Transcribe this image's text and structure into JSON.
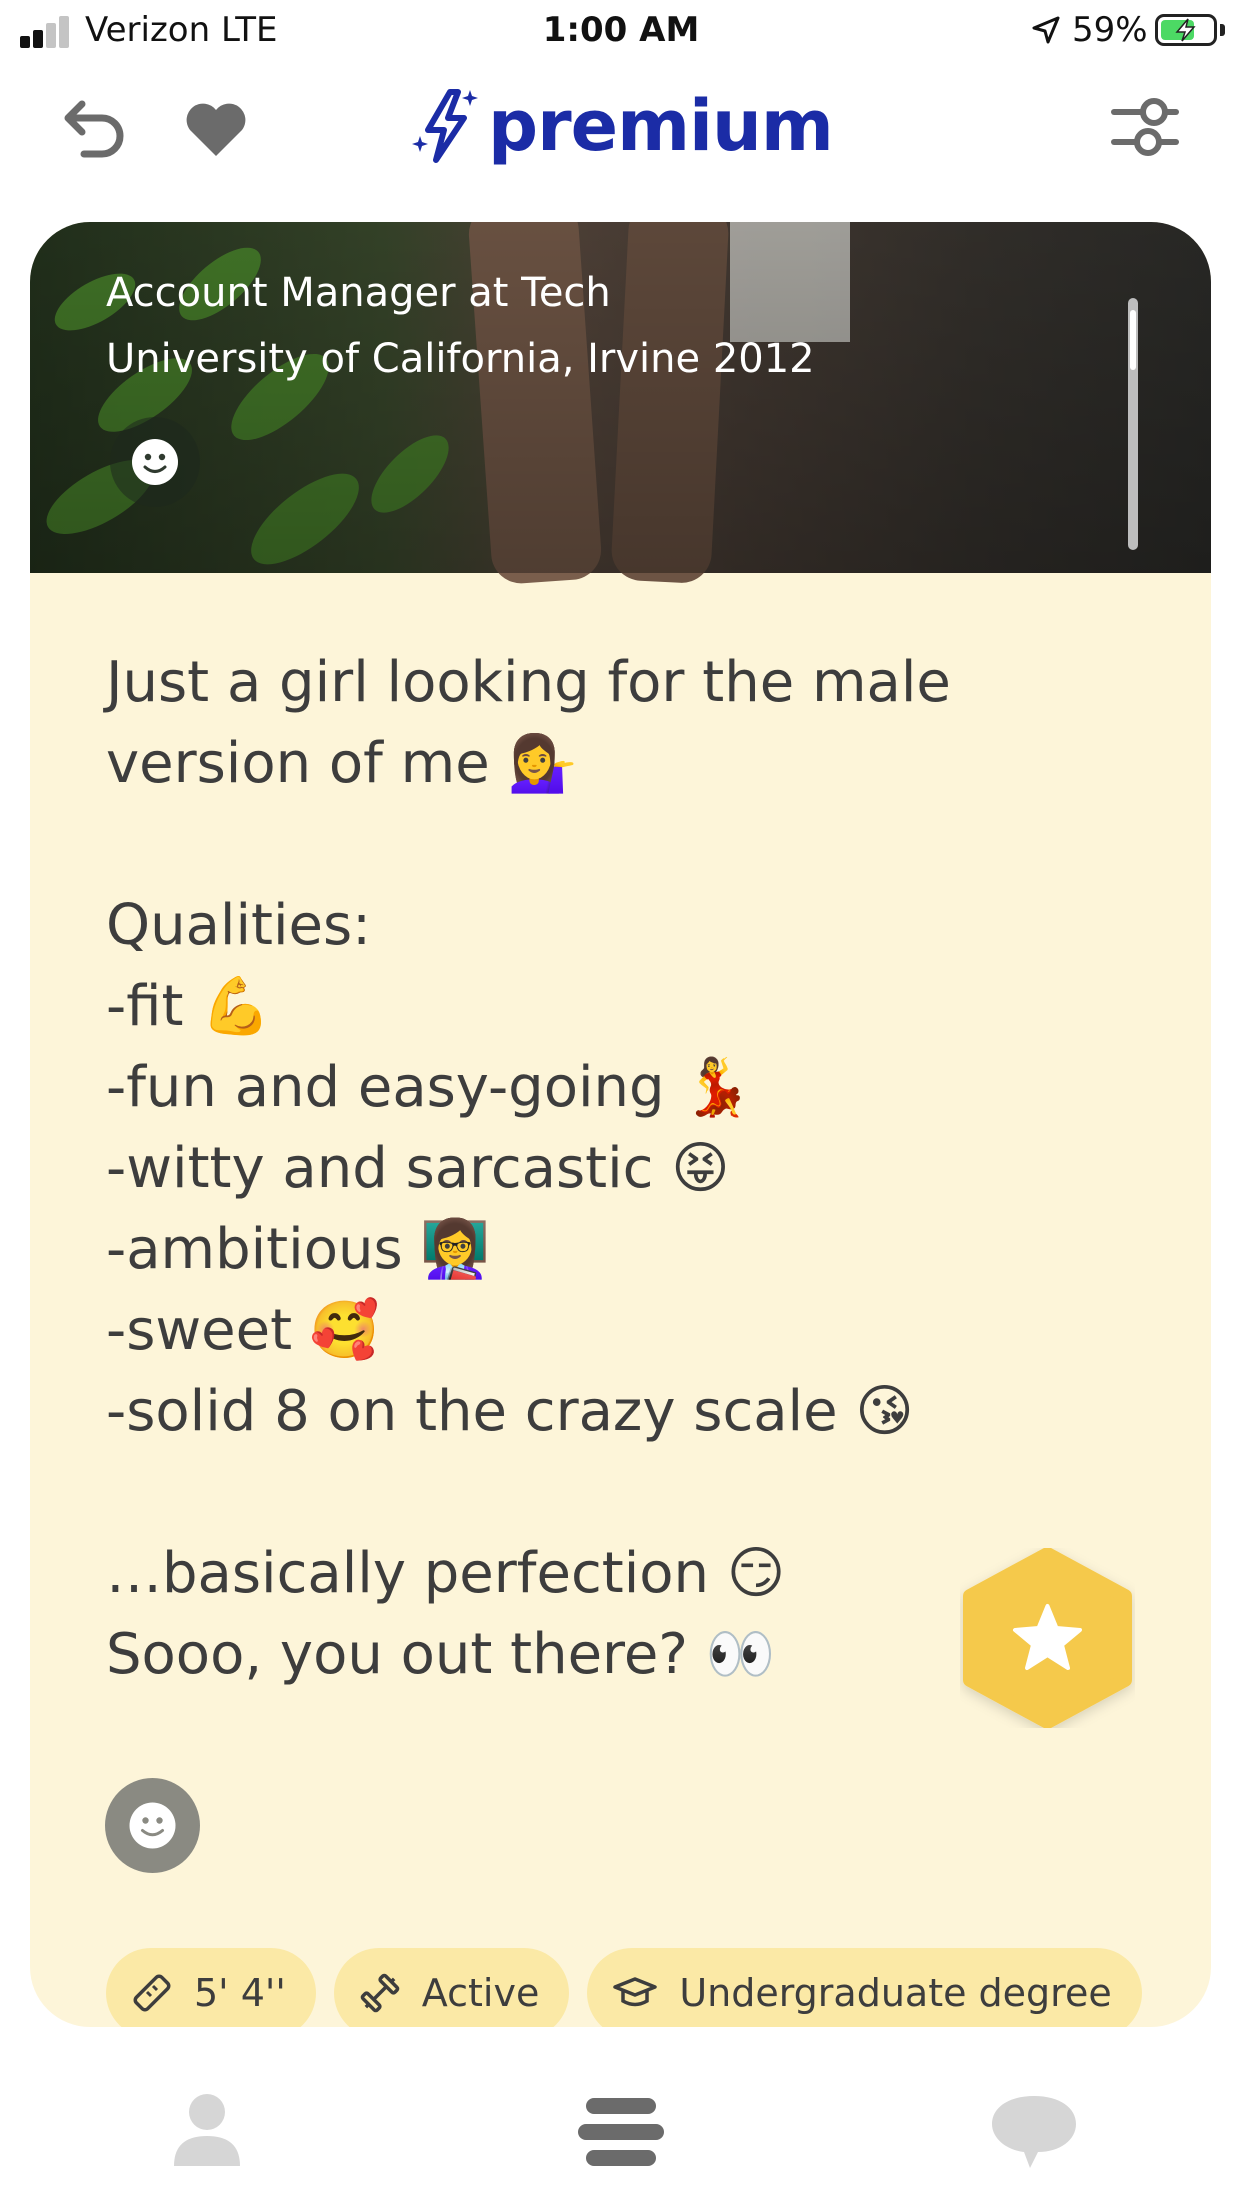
{
  "status_bar": {
    "carrier": "Verizon  LTE",
    "time": "1:00 AM",
    "battery_percent": "59%",
    "signal_bars": 2
  },
  "header": {
    "logo_text": "premium",
    "back_icon": "undo-icon",
    "like_icon": "heart-icon",
    "filter_icon": "sliders-icon",
    "brand_color": "#1b2ca6"
  },
  "profile": {
    "job": "Account Manager at Tech",
    "school": "University of California, Irvine 2012",
    "bio": "Just a girl looking for the male\nversion of me 💁‍♀️\n\nQualities:\n-fit 💪\n-fun and easy-going 💃\n-witty and sarcastic 😝\n-ambitious 👩‍🏫\n-sweet 🥰\n-solid 8 on the crazy scale 😘\n\n…basically perfection 😏\nSooo, you out there? 👀",
    "chips": [
      {
        "icon": "ruler-icon",
        "label": "5' 4''"
      },
      {
        "icon": "dumbbell-icon",
        "label": "Active"
      },
      {
        "icon": "graduation-cap-icon",
        "label": "Undergraduate degree"
      }
    ]
  },
  "actions": {
    "superswipe_icon": "star-icon",
    "superswipe_color": "#f5c94c",
    "react_icon": "smiley-icon"
  },
  "bottom_nav": [
    {
      "icon": "profile-icon",
      "active": false
    },
    {
      "icon": "cards-icon",
      "active": true
    },
    {
      "icon": "chat-icon",
      "active": false
    }
  ],
  "colors": {
    "card_background": "#fdf5d9",
    "chip_background": "#fbe9a6",
    "text": "#3d3d3d"
  }
}
